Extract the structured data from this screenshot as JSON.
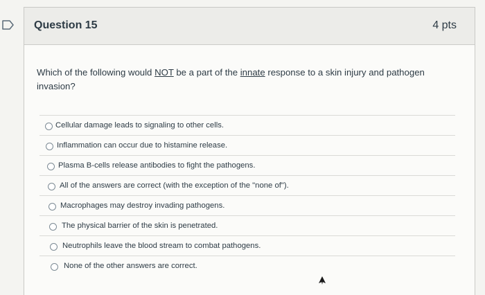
{
  "question": {
    "title": "Question 15",
    "points": "4 pts",
    "text_parts": [
      "Which of the following would ",
      "NOT",
      " be a part of the ",
      "innate",
      " response to a skin injury and pathogen invasion?"
    ]
  },
  "answers": [
    {
      "label": "Cellular damage leads to signaling to other cells."
    },
    {
      "label": "Inflammation can occur due to histamine release."
    },
    {
      "label": "Plasma B-cells release antibodies to fight the pathogens."
    },
    {
      "label": "All of the answers are correct (with the exception of the \"none of\")."
    },
    {
      "label": "Macrophages may destroy invading pathogens."
    },
    {
      "label": "The physical barrier of the skin is penetrated."
    },
    {
      "label": "Neutrophils leave the blood stream to combat pathogens."
    },
    {
      "label": "None of the other answers are correct."
    }
  ],
  "icons": {
    "flag": "flag-question-icon",
    "cursor": "mouse-pointer-icon"
  },
  "colors": {
    "text": "#2d3b45",
    "header_bg": "#ecece9",
    "border": "#c9c9c6"
  }
}
